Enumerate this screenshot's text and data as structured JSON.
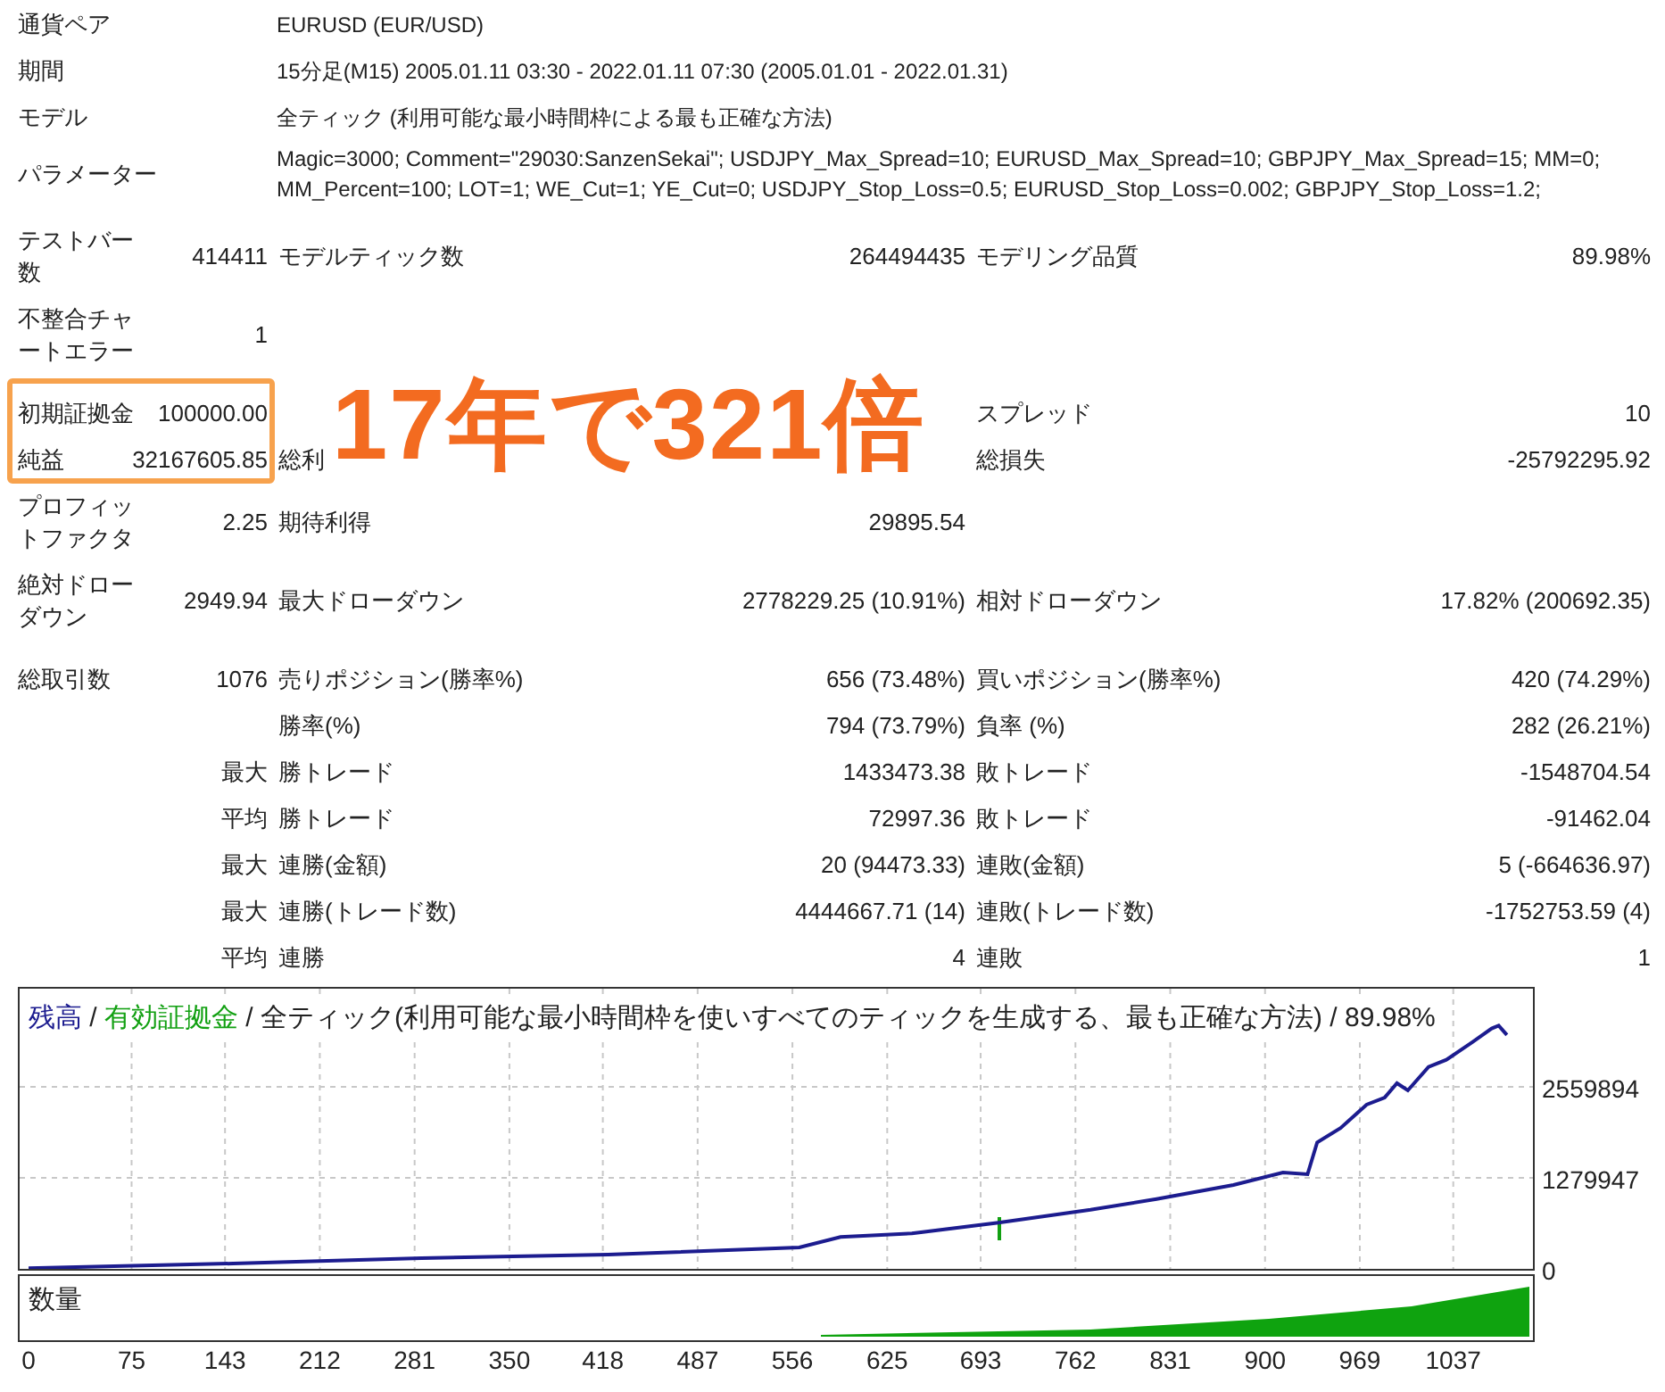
{
  "header": [
    {
      "label": "通貨ペア",
      "value": "EURUSD (EUR/USD)"
    },
    {
      "label": "期間",
      "value": "15分足(M15) 2005.01.11 03:30 - 2022.01.11 07:30 (2005.01.01 - 2022.01.31)"
    },
    {
      "label": "モデル",
      "value": "全ティック (利用可能な最小時間枠による最も正確な方法)"
    },
    {
      "label": "パラメーター",
      "value": "Magic=3000; Comment=\"29030:SanzenSekai\"; USDJPY_Max_Spread=10; EURUSD_Max_Spread=10; GBPJPY_Max_Spread=15; MM=0; MM_Percent=100; LOT=1; WE_Cut=1; YE_Cut=0; USDJPY_Stop_Loss=0.5; EURUSD_Stop_Loss=0.002; GBPJPY_Stop_Loss=1.2;"
    }
  ],
  "stat_groups": [
    [
      {
        "col1": {
          "label": "テストバー数",
          "value": "414411"
        },
        "col2": {
          "label": "モデルティック数",
          "value": "264494435"
        },
        "col3": {
          "label": "モデリング品質",
          "value": "89.98%"
        }
      },
      {
        "col1": {
          "label": "不整合チャートエラー",
          "value": "1"
        }
      }
    ],
    [
      {
        "col1": {
          "label": "初期証拠金",
          "value": "100000.00"
        },
        "col3": {
          "label": "スプレッド",
          "value": "10"
        }
      },
      {
        "col1": {
          "label": "純益",
          "value": "32167605.85"
        },
        "col2": {
          "label": "総利"
        },
        "col3": {
          "label": "総損失",
          "value": "-25792295.92"
        }
      },
      {
        "col1": {
          "label": "プロフィットファクタ",
          "value": "2.25"
        },
        "col2": {
          "label": "期待利得",
          "value": "29895.54"
        }
      },
      {
        "col1": {
          "label": "絶対ドローダウン",
          "value": "2949.94"
        },
        "col2": {
          "label": "最大ドローダウン",
          "value": "2778229.25 (10.91%)"
        },
        "col3": {
          "label": "相対ドローダウン",
          "value": "17.82% (200692.35)"
        }
      }
    ],
    [
      {
        "col1": {
          "label": "総取引数",
          "value": "1076"
        },
        "col2": {
          "label": "売りポジション(勝率%)",
          "value": "656 (73.48%)"
        },
        "col3": {
          "label": "買いポジション(勝率%)",
          "value": "420 (74.29%)"
        }
      },
      {
        "col2": {
          "label": "勝率(%)",
          "value": "794 (73.79%)"
        },
        "col3": {
          "label": "負率 (%)",
          "value": "282 (26.21%)"
        }
      },
      {
        "col1": {
          "value": "最大"
        },
        "col2": {
          "label": "勝トレード",
          "value": "1433473.38"
        },
        "col3": {
          "label": "敗トレード",
          "value": "-1548704.54"
        }
      },
      {
        "col1": {
          "value": "平均"
        },
        "col2": {
          "label": "勝トレード",
          "value": "72997.36"
        },
        "col3": {
          "label": "敗トレード",
          "value": "-91462.04"
        }
      },
      {
        "col1": {
          "value": "最大"
        },
        "col2": {
          "label": "連勝(金額)",
          "value": "20 (94473.33)"
        },
        "col3": {
          "label": "連敗(金額)",
          "value": "5 (-664636.97)"
        }
      },
      {
        "col1": {
          "value": "最大"
        },
        "col2": {
          "label": "連勝(トレード数)",
          "value": "4444667.71 (14)"
        },
        "col3": {
          "label": "連敗(トレード数)",
          "value": "-1752753.59 (4)"
        }
      },
      {
        "col1": {
          "value": "平均"
        },
        "col2": {
          "label": "連勝",
          "value": "4"
        },
        "col3": {
          "label": "連敗",
          "value": "1"
        }
      }
    ]
  ],
  "annotation": {
    "text": "17年で321倍"
  },
  "chart": {
    "legend": [
      {
        "text": " / ",
        "color": "#222222"
      },
      {
        "text": "有効証拠金",
        "color": "#12a012"
      },
      {
        "text": " / 全ティック(利用可能な最小時間枠を使いすべてのティックを生成する、最も正確な方法) / 89.98%",
        "color": "#222222"
      }
    ],
    "chart_data": {
      "type": "line",
      "x": [
        0,
        149,
        286,
        422,
        561,
        591,
        643,
        706,
        773,
        821,
        877,
        913,
        931,
        938,
        955,
        974,
        987,
        996,
        1004,
        1019,
        1032,
        1051,
        1065,
        1070,
        1076
      ],
      "series": [
        {
          "name": "残高",
          "color": "#1c1c8f",
          "values": [
            10000,
            75000,
            150000,
            200000,
            300000,
            450000,
            500000,
            650000,
            830000,
            980000,
            1180000,
            1355000,
            1330000,
            1780000,
            1980000,
            2310000,
            2410000,
            2610000,
            2510000,
            2840000,
            2940000,
            3190000,
            3380000,
            3420000,
            3290000
          ]
        }
      ],
      "yticks": [
        0,
        1279947,
        2559894
      ],
      "xlim": [
        -6.5,
        1095
      ],
      "ylim": [
        0,
        3940000
      ],
      "grid": true,
      "xticks": [
        0,
        75,
        143,
        212,
        281,
        350,
        418,
        487,
        556,
        625,
        693,
        762,
        831,
        900,
        969,
        1037
      ]
    },
    "volume": {
      "label": "数量",
      "color": "#0fa30f"
    }
  }
}
